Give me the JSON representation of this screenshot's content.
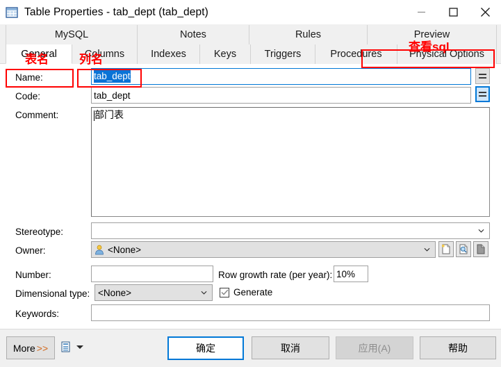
{
  "window": {
    "title": "Table Properties - tab_dept (tab_dept)",
    "icon": "table-grid-icon",
    "minimize_label": "—",
    "maximize_label": "□",
    "close_label": "✕"
  },
  "tabs": {
    "top_row": [
      {
        "label": "MySQL",
        "selected": false
      },
      {
        "label": "Notes",
        "selected": false
      },
      {
        "label": "Rules",
        "selected": false
      },
      {
        "label": "Preview",
        "selected": false
      }
    ],
    "bottom_row": [
      {
        "label": "General",
        "selected": true
      },
      {
        "label": "Columns",
        "selected": false
      },
      {
        "label": "Indexes",
        "selected": false
      },
      {
        "label": "Keys",
        "selected": false
      },
      {
        "label": "Triggers",
        "selected": false
      },
      {
        "label": "Procedures",
        "selected": false
      },
      {
        "label": "Physical Options",
        "selected": false
      }
    ]
  },
  "annotations": {
    "color": "#ff0000",
    "table_name": "表名",
    "column_name": "列名",
    "view_sql": "查看sql"
  },
  "form": {
    "name_label": "Name:",
    "name_value": "tab_dept",
    "code_label": "Code:",
    "code_value": "tab_dept",
    "comment_label": "Comment:",
    "comment_value": "部门表",
    "stereotype_label": "Stereotype:",
    "stereotype_value": "",
    "owner_label": "Owner:",
    "owner_value": "<None>",
    "number_label": "Number:",
    "number_value": "",
    "row_growth_label": "Row growth rate (per year):",
    "row_growth_value": "10%",
    "dimensional_label": "Dimensional type:",
    "dimensional_value": "<None>",
    "generate_label": "Generate",
    "generate_checked": true,
    "keywords_label": "Keywords:",
    "keywords_value": "",
    "equals_button_label": "=",
    "owner_buttons": [
      "new-owner-icon",
      "browse-owner-icon",
      "owner-properties-icon"
    ]
  },
  "footer": {
    "more_label": "More",
    "more_arrows": ">>",
    "report_icon": "report-icon",
    "ok_label": "确定",
    "cancel_label": "取消",
    "apply_label": "应用(A)",
    "help_label": "帮助"
  },
  "colors": {
    "accent": "#0078d7",
    "selection": "#0a73d6",
    "annotation": "#ff0000",
    "panel": "#f0f0f0"
  }
}
